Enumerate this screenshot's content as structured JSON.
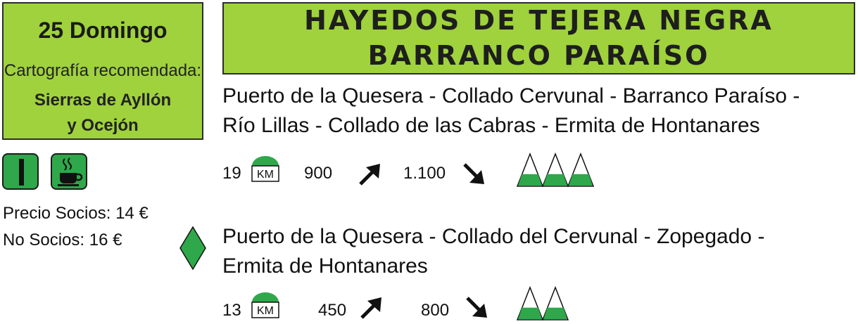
{
  "event": {
    "date": "25 Domingo",
    "cartography_label": "Cartografía recomendada:",
    "cartography_map_line1": "Sierras de Ayllón",
    "cartography_map_line2": "y Ocejón"
  },
  "title": {
    "line1": "HAYEDOS DE TEJERA NEGRA",
    "line2": "BARRANCO PARAÍSO"
  },
  "prices": {
    "members": "Precio Socios: 14 €",
    "non_members": "No Socios: 16 €"
  },
  "icons": {
    "level": "level-bar-icon",
    "food": "coffee-cup-icon",
    "route_b_marker": "green-diamond-icon"
  },
  "colors": {
    "accent_green": "#9fd23c",
    "icon_green": "#2ea84a",
    "mountain_green": "#2ea84a"
  },
  "routes": [
    {
      "line1": "Puerto de la Quesera - Collado Cervunal - Barranco Paraíso -",
      "line2": "Río Lillas - Collado de las Cabras - Ermita de Hontanares",
      "distance": "19",
      "km_label": "KM",
      "ascent": "900",
      "descent": "1.100",
      "difficulty": 3
    },
    {
      "line1": "Puerto de la Quesera - Collado del Cervunal - Zopegado -",
      "line2": "Ermita de Hontanares",
      "distance": "13",
      "km_label": "KM",
      "ascent": "450",
      "descent": "800",
      "difficulty": 2
    }
  ]
}
